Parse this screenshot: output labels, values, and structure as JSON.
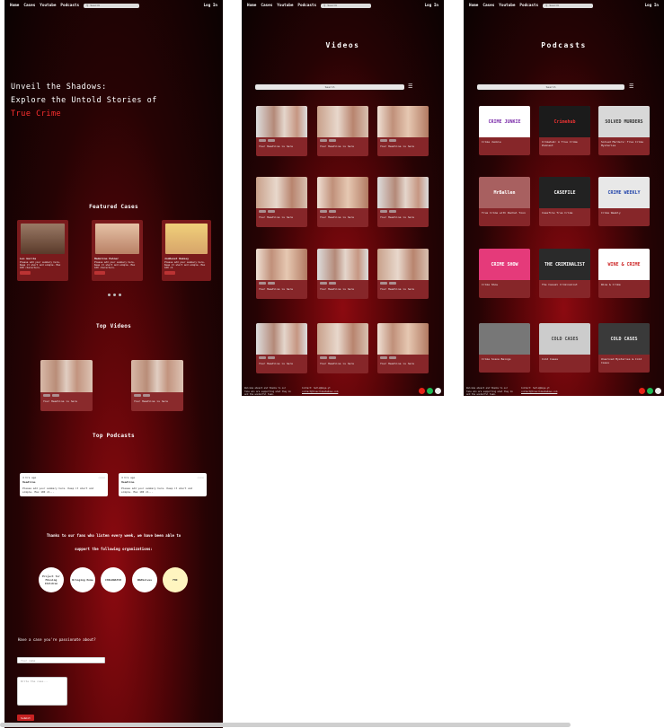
{
  "nav": {
    "home": "Home",
    "cases": "Cases",
    "youtube": "Youtube",
    "podcasts": "Podcasts",
    "search_placeholder": "Search",
    "login": "Log In"
  },
  "home": {
    "hero_line1": "Unveil the Shadows:",
    "hero_line2": "Explore the Untold Stories of",
    "hero_line3": "True Crime",
    "featured_title": "Featured Cases",
    "cases": [
      {
        "name": "Leo Garcia",
        "desc": "Please add your summary here. Keep it short and simple. Max 100 characters.",
        "btn": "Read"
      },
      {
        "name": "Madeline Palmer",
        "desc": "Please add your summary here. Keep it short and simple. Max 100 characters.",
        "btn": "Read"
      },
      {
        "name": "JonBenet Ramsey",
        "desc": "Please add your summary here. Keep it short and simple. Max 100 ch",
        "btn": "Read"
      }
    ],
    "top_videos_title": "Top Videos",
    "videos": [
      {
        "title": "Your Headline is here"
      },
      {
        "title": "Your Headline is here"
      }
    ],
    "top_podcasts_title": "Top Podcasts",
    "podcasts": [
      {
        "meta": "4 hrs ago",
        "title": "Headline",
        "desc": "Please add your summary here. Keep it short and simple. Max 100 ch..."
      },
      {
        "meta": "4 hrs ago",
        "title": "Headline",
        "desc": "Please add your summary here. Keep it short and simple. Max 100 ch..."
      }
    ],
    "thanks_line1": "Thanks to our fans who listen every week, we have been able to",
    "thanks_line2": "support the following organizations:",
    "orgs": [
      "Project for Missing Children",
      "Bringing Home",
      "CHILDWATCH",
      "DNASolves",
      "FBI"
    ],
    "contact_label": "Have a case you're passionate about?",
    "name_placeholder": "Your name",
    "message_placeholder": "Write the case...",
    "submit": "Submit"
  },
  "videos_page": {
    "title": "Videos",
    "search": "Search",
    "card_title": "Your Headline is here"
  },
  "podcasts_page": {
    "title": "Podcasts",
    "search": "Search",
    "items": [
      {
        "cover": "CRIME JUNKIE",
        "title": "Crime Junkie"
      },
      {
        "cover": "Crimehub",
        "title": "Crimehub: A True Crime Podcast"
      },
      {
        "cover": "SOLVED MURDERS",
        "title": "Solved Murders: True Crime Mysteries"
      },
      {
        "cover": "MrBallen",
        "title": "True Crime with Rachel Yoon"
      },
      {
        "cover": "CASEFILE",
        "title": "Casefile True Crime"
      },
      {
        "cover": "CRIME WEEKLY",
        "title": "Crime Weekly"
      },
      {
        "cover": "CRIME SHOW",
        "title": "Crime Show"
      },
      {
        "cover": "THE CRIMINALIST",
        "title": "The Casual Criminalist"
      },
      {
        "cover": "WINE & CRIME",
        "title": "Wine & Crime"
      },
      {
        "cover": "",
        "title": "Crime Scene Beings"
      },
      {
        "cover": "COLD CASES",
        "title": "Cold Cases"
      },
      {
        "cover": "COLD CASES",
        "title": "Unsolved Mysteries & Cold Cases"
      }
    ]
  },
  "footer": {
    "about": "Welcome aboard and thanks to our fans who are supporting what they do and the wonderful team.",
    "contact_title": "Contact: hello@maya.yt",
    "contact_link": "contact@truecrimeshadows.com"
  },
  "colors": {
    "accent": "#ff3030",
    "card": "#862629",
    "youtube": "#e62117",
    "spotify": "#1db954",
    "apple": "#8e5cf7"
  }
}
